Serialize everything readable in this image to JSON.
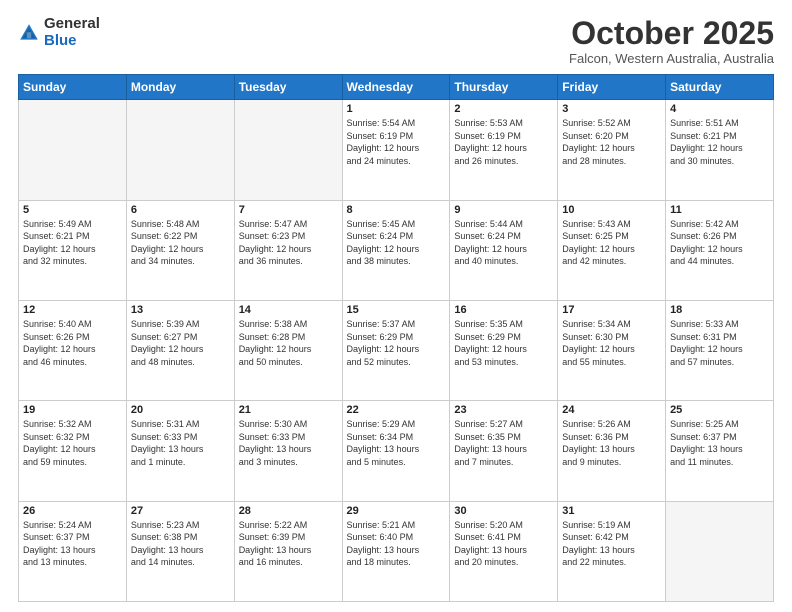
{
  "header": {
    "logo_general": "General",
    "logo_blue": "Blue",
    "title": "October 2025",
    "subtitle": "Falcon, Western Australia, Australia"
  },
  "days_header": [
    "Sunday",
    "Monday",
    "Tuesday",
    "Wednesday",
    "Thursday",
    "Friday",
    "Saturday"
  ],
  "weeks": [
    [
      {
        "day": "",
        "info": ""
      },
      {
        "day": "",
        "info": ""
      },
      {
        "day": "",
        "info": ""
      },
      {
        "day": "1",
        "info": "Sunrise: 5:54 AM\nSunset: 6:19 PM\nDaylight: 12 hours\nand 24 minutes."
      },
      {
        "day": "2",
        "info": "Sunrise: 5:53 AM\nSunset: 6:19 PM\nDaylight: 12 hours\nand 26 minutes."
      },
      {
        "day": "3",
        "info": "Sunrise: 5:52 AM\nSunset: 6:20 PM\nDaylight: 12 hours\nand 28 minutes."
      },
      {
        "day": "4",
        "info": "Sunrise: 5:51 AM\nSunset: 6:21 PM\nDaylight: 12 hours\nand 30 minutes."
      }
    ],
    [
      {
        "day": "5",
        "info": "Sunrise: 5:49 AM\nSunset: 6:21 PM\nDaylight: 12 hours\nand 32 minutes."
      },
      {
        "day": "6",
        "info": "Sunrise: 5:48 AM\nSunset: 6:22 PM\nDaylight: 12 hours\nand 34 minutes."
      },
      {
        "day": "7",
        "info": "Sunrise: 5:47 AM\nSunset: 6:23 PM\nDaylight: 12 hours\nand 36 minutes."
      },
      {
        "day": "8",
        "info": "Sunrise: 5:45 AM\nSunset: 6:24 PM\nDaylight: 12 hours\nand 38 minutes."
      },
      {
        "day": "9",
        "info": "Sunrise: 5:44 AM\nSunset: 6:24 PM\nDaylight: 12 hours\nand 40 minutes."
      },
      {
        "day": "10",
        "info": "Sunrise: 5:43 AM\nSunset: 6:25 PM\nDaylight: 12 hours\nand 42 minutes."
      },
      {
        "day": "11",
        "info": "Sunrise: 5:42 AM\nSunset: 6:26 PM\nDaylight: 12 hours\nand 44 minutes."
      }
    ],
    [
      {
        "day": "12",
        "info": "Sunrise: 5:40 AM\nSunset: 6:26 PM\nDaylight: 12 hours\nand 46 minutes."
      },
      {
        "day": "13",
        "info": "Sunrise: 5:39 AM\nSunset: 6:27 PM\nDaylight: 12 hours\nand 48 minutes."
      },
      {
        "day": "14",
        "info": "Sunrise: 5:38 AM\nSunset: 6:28 PM\nDaylight: 12 hours\nand 50 minutes."
      },
      {
        "day": "15",
        "info": "Sunrise: 5:37 AM\nSunset: 6:29 PM\nDaylight: 12 hours\nand 52 minutes."
      },
      {
        "day": "16",
        "info": "Sunrise: 5:35 AM\nSunset: 6:29 PM\nDaylight: 12 hours\nand 53 minutes."
      },
      {
        "day": "17",
        "info": "Sunrise: 5:34 AM\nSunset: 6:30 PM\nDaylight: 12 hours\nand 55 minutes."
      },
      {
        "day": "18",
        "info": "Sunrise: 5:33 AM\nSunset: 6:31 PM\nDaylight: 12 hours\nand 57 minutes."
      }
    ],
    [
      {
        "day": "19",
        "info": "Sunrise: 5:32 AM\nSunset: 6:32 PM\nDaylight: 12 hours\nand 59 minutes."
      },
      {
        "day": "20",
        "info": "Sunrise: 5:31 AM\nSunset: 6:33 PM\nDaylight: 13 hours\nand 1 minute."
      },
      {
        "day": "21",
        "info": "Sunrise: 5:30 AM\nSunset: 6:33 PM\nDaylight: 13 hours\nand 3 minutes."
      },
      {
        "day": "22",
        "info": "Sunrise: 5:29 AM\nSunset: 6:34 PM\nDaylight: 13 hours\nand 5 minutes."
      },
      {
        "day": "23",
        "info": "Sunrise: 5:27 AM\nSunset: 6:35 PM\nDaylight: 13 hours\nand 7 minutes."
      },
      {
        "day": "24",
        "info": "Sunrise: 5:26 AM\nSunset: 6:36 PM\nDaylight: 13 hours\nand 9 minutes."
      },
      {
        "day": "25",
        "info": "Sunrise: 5:25 AM\nSunset: 6:37 PM\nDaylight: 13 hours\nand 11 minutes."
      }
    ],
    [
      {
        "day": "26",
        "info": "Sunrise: 5:24 AM\nSunset: 6:37 PM\nDaylight: 13 hours\nand 13 minutes."
      },
      {
        "day": "27",
        "info": "Sunrise: 5:23 AM\nSunset: 6:38 PM\nDaylight: 13 hours\nand 14 minutes."
      },
      {
        "day": "28",
        "info": "Sunrise: 5:22 AM\nSunset: 6:39 PM\nDaylight: 13 hours\nand 16 minutes."
      },
      {
        "day": "29",
        "info": "Sunrise: 5:21 AM\nSunset: 6:40 PM\nDaylight: 13 hours\nand 18 minutes."
      },
      {
        "day": "30",
        "info": "Sunrise: 5:20 AM\nSunset: 6:41 PM\nDaylight: 13 hours\nand 20 minutes."
      },
      {
        "day": "31",
        "info": "Sunrise: 5:19 AM\nSunset: 6:42 PM\nDaylight: 13 hours\nand 22 minutes."
      },
      {
        "day": "",
        "info": ""
      }
    ]
  ]
}
